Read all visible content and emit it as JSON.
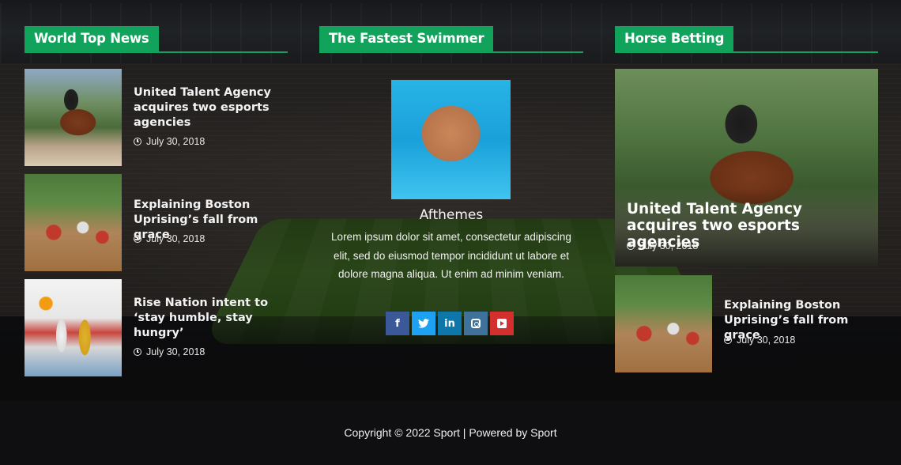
{
  "left_widget": {
    "title": "World Top News",
    "posts": [
      {
        "title": "United Talent Agency acquires two esports agencies",
        "date": "July 30, 2018",
        "image": "horse-jumping-photo"
      },
      {
        "title": "Explaining Boston Uprising’s fall from grace",
        "date": "July 30, 2018",
        "image": "motocross-photo"
      },
      {
        "title": "Rise Nation intent to ‘stay humble, stay hungry’",
        "date": "July 30, 2018",
        "image": "volleyball-photo"
      }
    ]
  },
  "middle_widget": {
    "title": "The Fastest Swimmer",
    "author_name": "Afthemes",
    "author_bio": "Lorem ipsum dolor sit amet, consectetur adipiscing elit, sed do eiusmod tempor incididunt ut labore et dolore magna aliqua. Ut enim ad minim veniam.",
    "socials": [
      {
        "name": "facebook-icon",
        "glyph": "f",
        "color": "#3b5998"
      },
      {
        "name": "twitter-icon",
        "glyph": "t",
        "color": "#1da1f2"
      },
      {
        "name": "linkedin-icon",
        "glyph": "in",
        "color": "#0e76a8"
      },
      {
        "name": "instagram-icon",
        "glyph": "",
        "color": "#3f729b"
      },
      {
        "name": "youtube-icon",
        "glyph": "",
        "color": "#d32f2f"
      }
    ]
  },
  "right_widget": {
    "title": "Horse Betting",
    "featured": {
      "title": "United Talent Agency acquires two esports agencies",
      "date": "July 30, 2018"
    },
    "posts": [
      {
        "title": "Explaining Boston Uprising’s fall from grace",
        "date": "July 30, 2018"
      }
    ]
  },
  "footer": {
    "copyright": "Copyright © 2022 Sport | Powered by Sport"
  },
  "colors": {
    "accent": "#11a35b",
    "footer_bg": "#0f0f12"
  }
}
